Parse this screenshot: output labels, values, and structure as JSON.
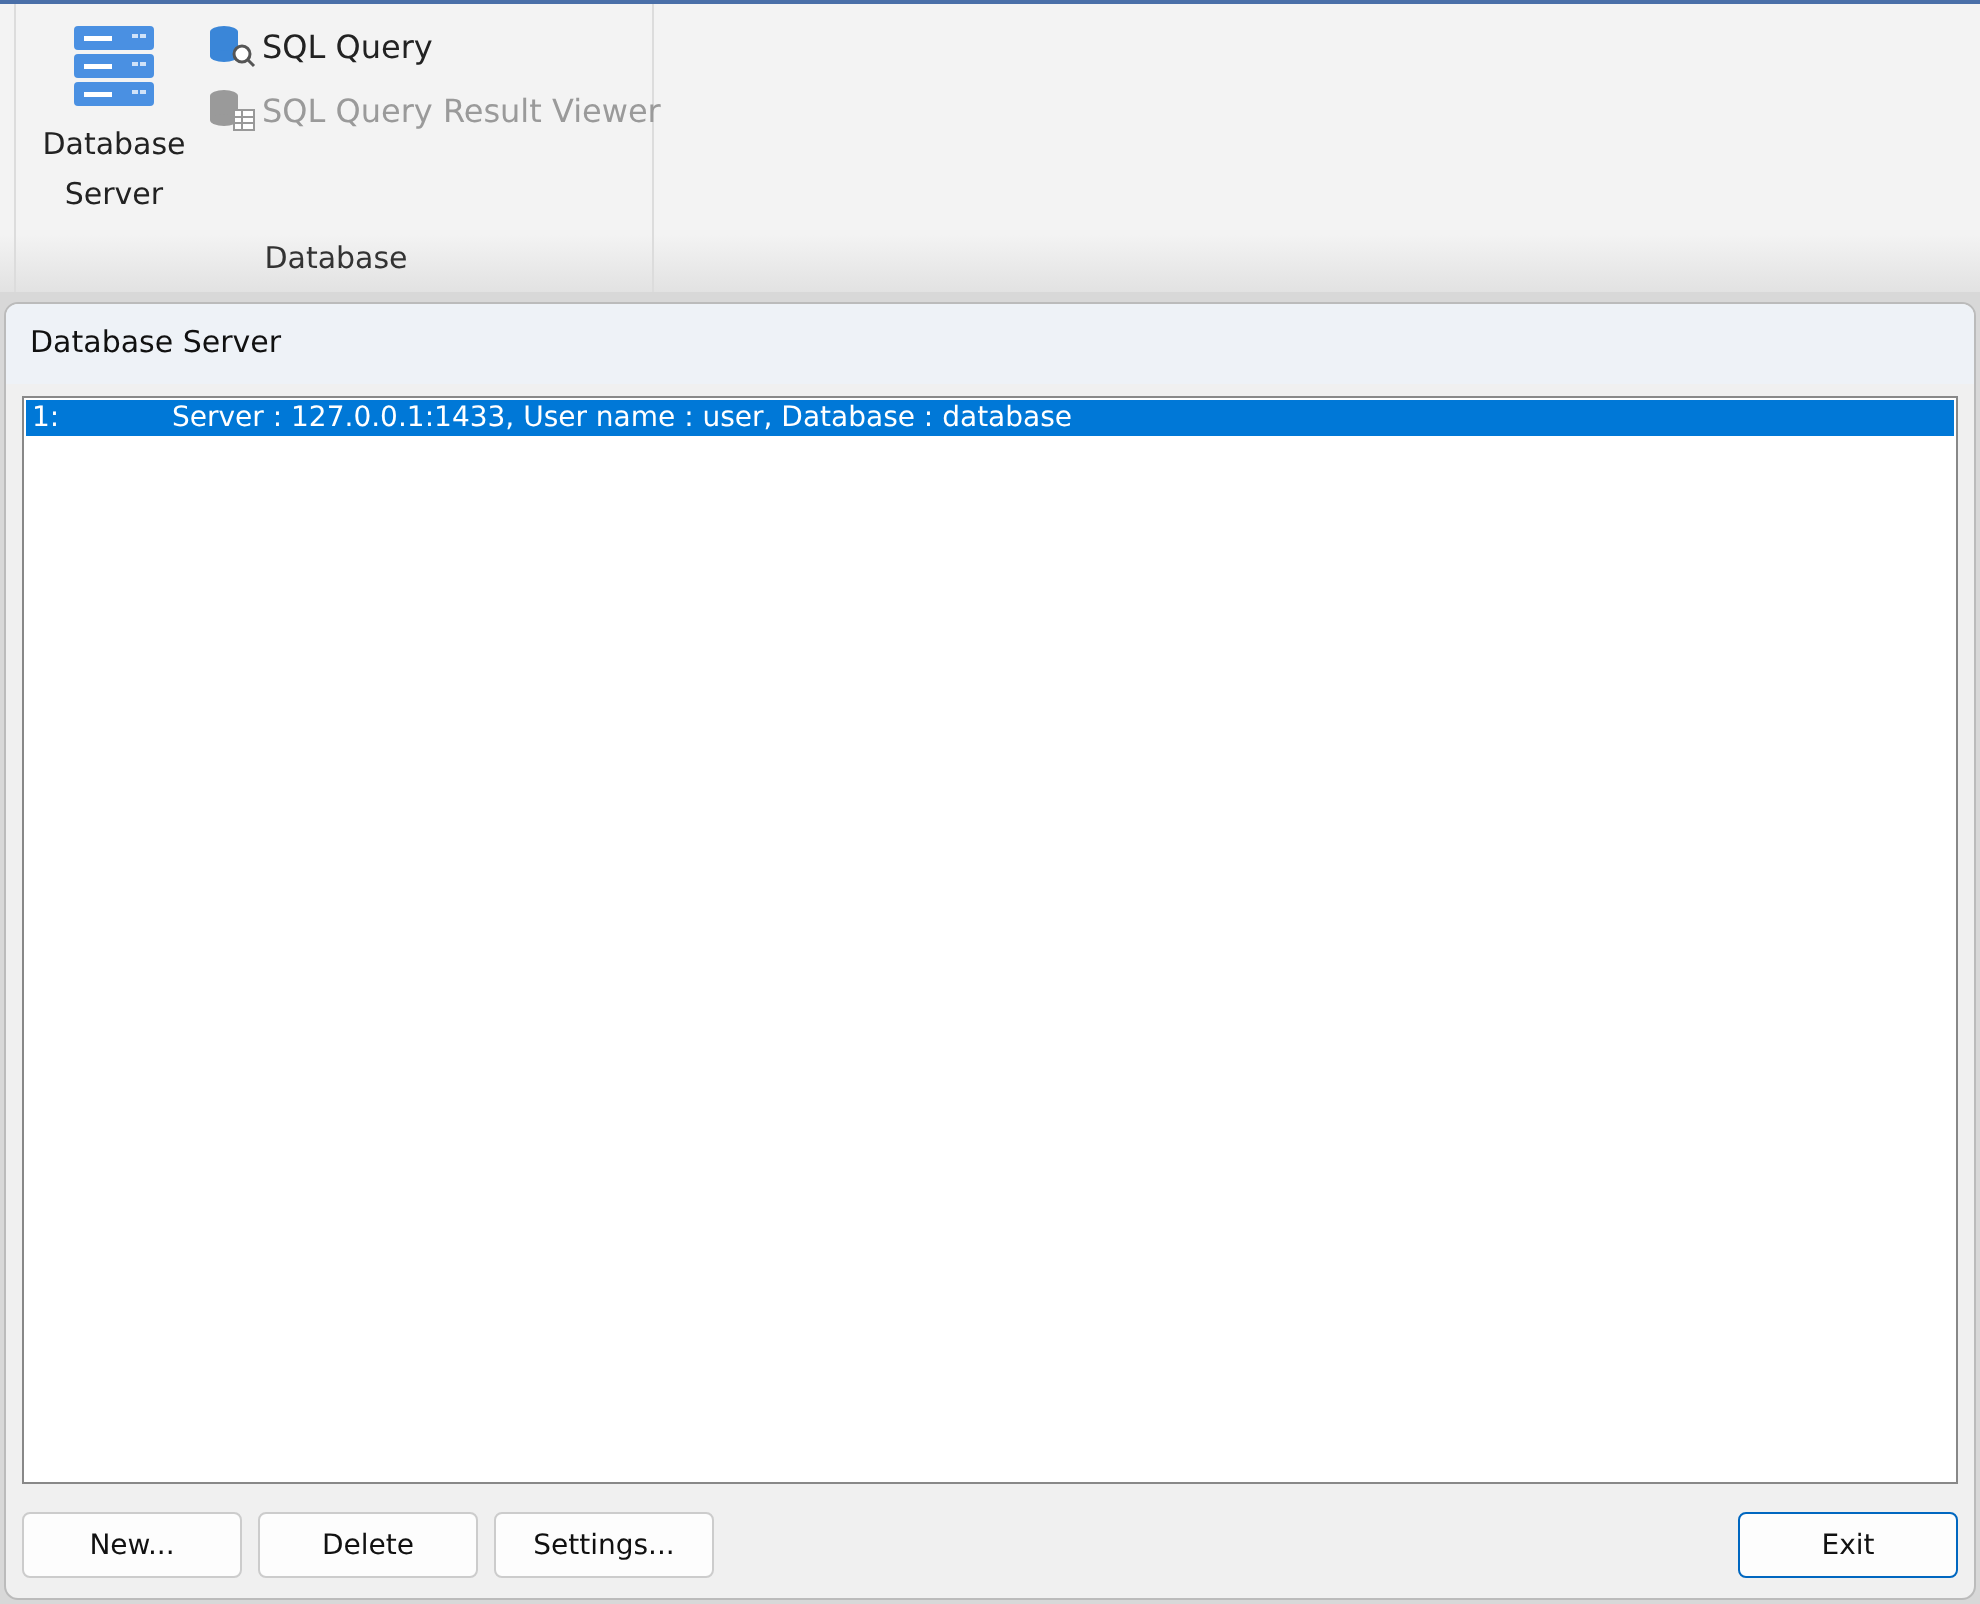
{
  "ribbon": {
    "large_button": {
      "label": "Database Server"
    },
    "small_buttons": [
      {
        "label": "SQL Query",
        "disabled": false
      },
      {
        "label": "SQL Query Result Viewer",
        "disabled": true
      }
    ],
    "group_label": "Database"
  },
  "dialog": {
    "title": "Database Server",
    "rows": [
      {
        "number": "1:",
        "text": "Server : 127.0.0.1:1433, User name : user, Database : database",
        "selected": true
      }
    ],
    "left_buttons": [
      {
        "label": "New...",
        "default": false
      },
      {
        "label": "Delete",
        "default": false
      },
      {
        "label": "Settings...",
        "default": false
      }
    ],
    "right_buttons": [
      {
        "label": "Exit",
        "default": true
      }
    ]
  }
}
